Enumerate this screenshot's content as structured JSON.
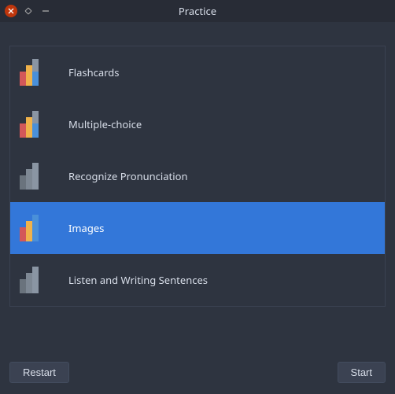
{
  "window": {
    "title": "Practice"
  },
  "modes": {
    "items": [
      {
        "label": "Flashcards",
        "icon": "color-half",
        "selected": false
      },
      {
        "label": "Multiple-choice",
        "icon": "color-half",
        "selected": false
      },
      {
        "label": "Recognize Pronunciation",
        "icon": "mono",
        "selected": false
      },
      {
        "label": "Images",
        "icon": "color-full",
        "selected": true
      },
      {
        "label": "Listen and Writing Sentences",
        "icon": "mono",
        "selected": false
      }
    ]
  },
  "buttons": {
    "restart": "Restart",
    "start": "Start"
  }
}
